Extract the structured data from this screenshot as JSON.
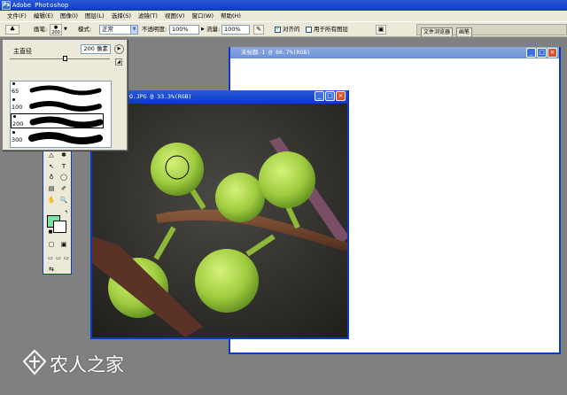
{
  "app": {
    "title": "Adobe Photoshop",
    "icon_label": "Ps"
  },
  "menu": [
    "文件(F)",
    "编辑(E)",
    "图像(I)",
    "图层(L)",
    "选择(S)",
    "滤镜(T)",
    "视图(V)",
    "窗口(W)",
    "帮助(H)"
  ],
  "options": {
    "brush_label": "画笔:",
    "brush_size": "200",
    "mode_label": "模式:",
    "mode_value": "正常",
    "opacity_label": "不透明度:",
    "opacity_value": "100%",
    "flow_label": "流量:",
    "flow_value": "100%",
    "aligned_label": "对齐的",
    "aligned_checked": true,
    "all_layers_label": "用于所有图层",
    "all_layers_checked": false
  },
  "palette_well": {
    "tabs": [
      "文件浏览器",
      "画笔"
    ]
  },
  "brush_popup": {
    "master_diameter_label": "主直径",
    "master_diameter_value": "200 像素",
    "slider_fraction": 0.55,
    "brushes": [
      {
        "size": "65"
      },
      {
        "size": "100"
      },
      {
        "size": "200",
        "selected": true
      },
      {
        "size": "300"
      }
    ]
  },
  "toolbox": {
    "foreground_color": "#7be3a1",
    "background_color": "#ffffff"
  },
  "documents": [
    {
      "title": "O.JPG @ 33.3%(RGB)"
    },
    {
      "title": "未标题-1 @ 66.7%(RGB)"
    }
  ],
  "watermark": {
    "text": "农人之家"
  },
  "colors": {
    "xp_blue": "#0a3bc4",
    "menu_bg": "#ece9d8",
    "workspace": "#808080",
    "fig_green": "#a9d64a"
  }
}
